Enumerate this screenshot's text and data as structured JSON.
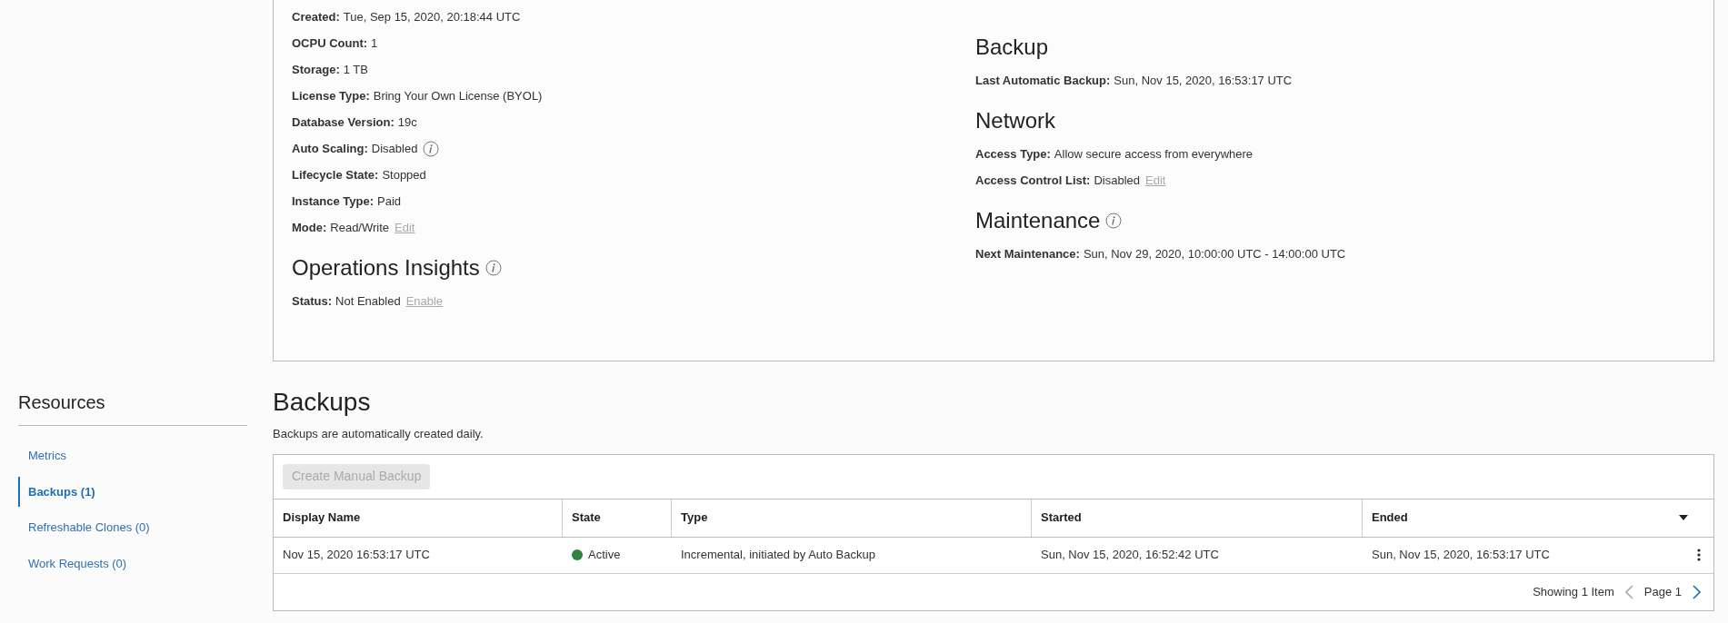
{
  "details": {
    "left": [
      {
        "kind": "field",
        "label": "Created:",
        "value": "Tue, Sep 15, 2020, 20:18:44 UTC"
      },
      {
        "kind": "field",
        "label": "OCPU Count:",
        "value": "1"
      },
      {
        "kind": "field",
        "label": "Storage:",
        "value": "1 TB"
      },
      {
        "kind": "field",
        "label": "License Type:",
        "value": "Bring Your Own License (BYOL)"
      },
      {
        "kind": "field",
        "label": "Database Version:",
        "value": "19c"
      },
      {
        "kind": "field",
        "label": "Auto Scaling:",
        "value": "Disabled",
        "info": true
      },
      {
        "kind": "field",
        "label": "Lifecycle State:",
        "value": "Stopped"
      },
      {
        "kind": "field",
        "label": "Instance Type:",
        "value": "Paid"
      },
      {
        "kind": "field",
        "label": "Mode:",
        "value": "Read/Write",
        "link": "Edit"
      },
      {
        "kind": "heading",
        "text": "Operations Insights",
        "info": true
      },
      {
        "kind": "field",
        "label": "Status:",
        "value": "Not Enabled",
        "link": "Enable"
      }
    ],
    "right": [
      {
        "kind": "heading",
        "text": "Backup",
        "info": false
      },
      {
        "kind": "field",
        "label": "Last Automatic Backup:",
        "value": "Sun, Nov 15, 2020, 16:53:17 UTC"
      },
      {
        "kind": "heading",
        "text": "Network",
        "info": false
      },
      {
        "kind": "field",
        "label": "Access Type:",
        "value": "Allow secure access from everywhere"
      },
      {
        "kind": "field",
        "label": "Access Control List:",
        "value": "Disabled",
        "link": "Edit"
      },
      {
        "kind": "heading",
        "text": "Maintenance",
        "info": true
      },
      {
        "kind": "field",
        "label": "Next Maintenance:",
        "value": "Sun, Nov 29, 2020, 10:00:00 UTC - 14:00:00 UTC"
      }
    ]
  },
  "resources": {
    "title": "Resources",
    "items": [
      {
        "label": "Metrics",
        "selected": false
      },
      {
        "label": "Backups (1)",
        "selected": true
      },
      {
        "label": "Refreshable Clones (0)",
        "selected": false
      },
      {
        "label": "Work Requests (0)",
        "selected": false
      }
    ]
  },
  "backups": {
    "title": "Backups",
    "description": "Backups are automatically created daily.",
    "button": {
      "label": "Create Manual Backup",
      "disabled": true
    },
    "columns": [
      "Display Name",
      "State",
      "Type",
      "Started",
      "Ended"
    ],
    "rows": [
      {
        "display_name": "Nov 15, 2020 16:53:17 UTC",
        "state": "Active",
        "color": "#2e8540",
        "type": "Incremental, initiated by Auto Backup",
        "started": "Sun, Nov 15, 2020, 16:52:42 UTC",
        "ended": "Sun, Nov 15, 2020, 16:53:17 UTC"
      }
    ],
    "footer": {
      "count": "Showing 1 Item",
      "page": "Page 1"
    }
  }
}
